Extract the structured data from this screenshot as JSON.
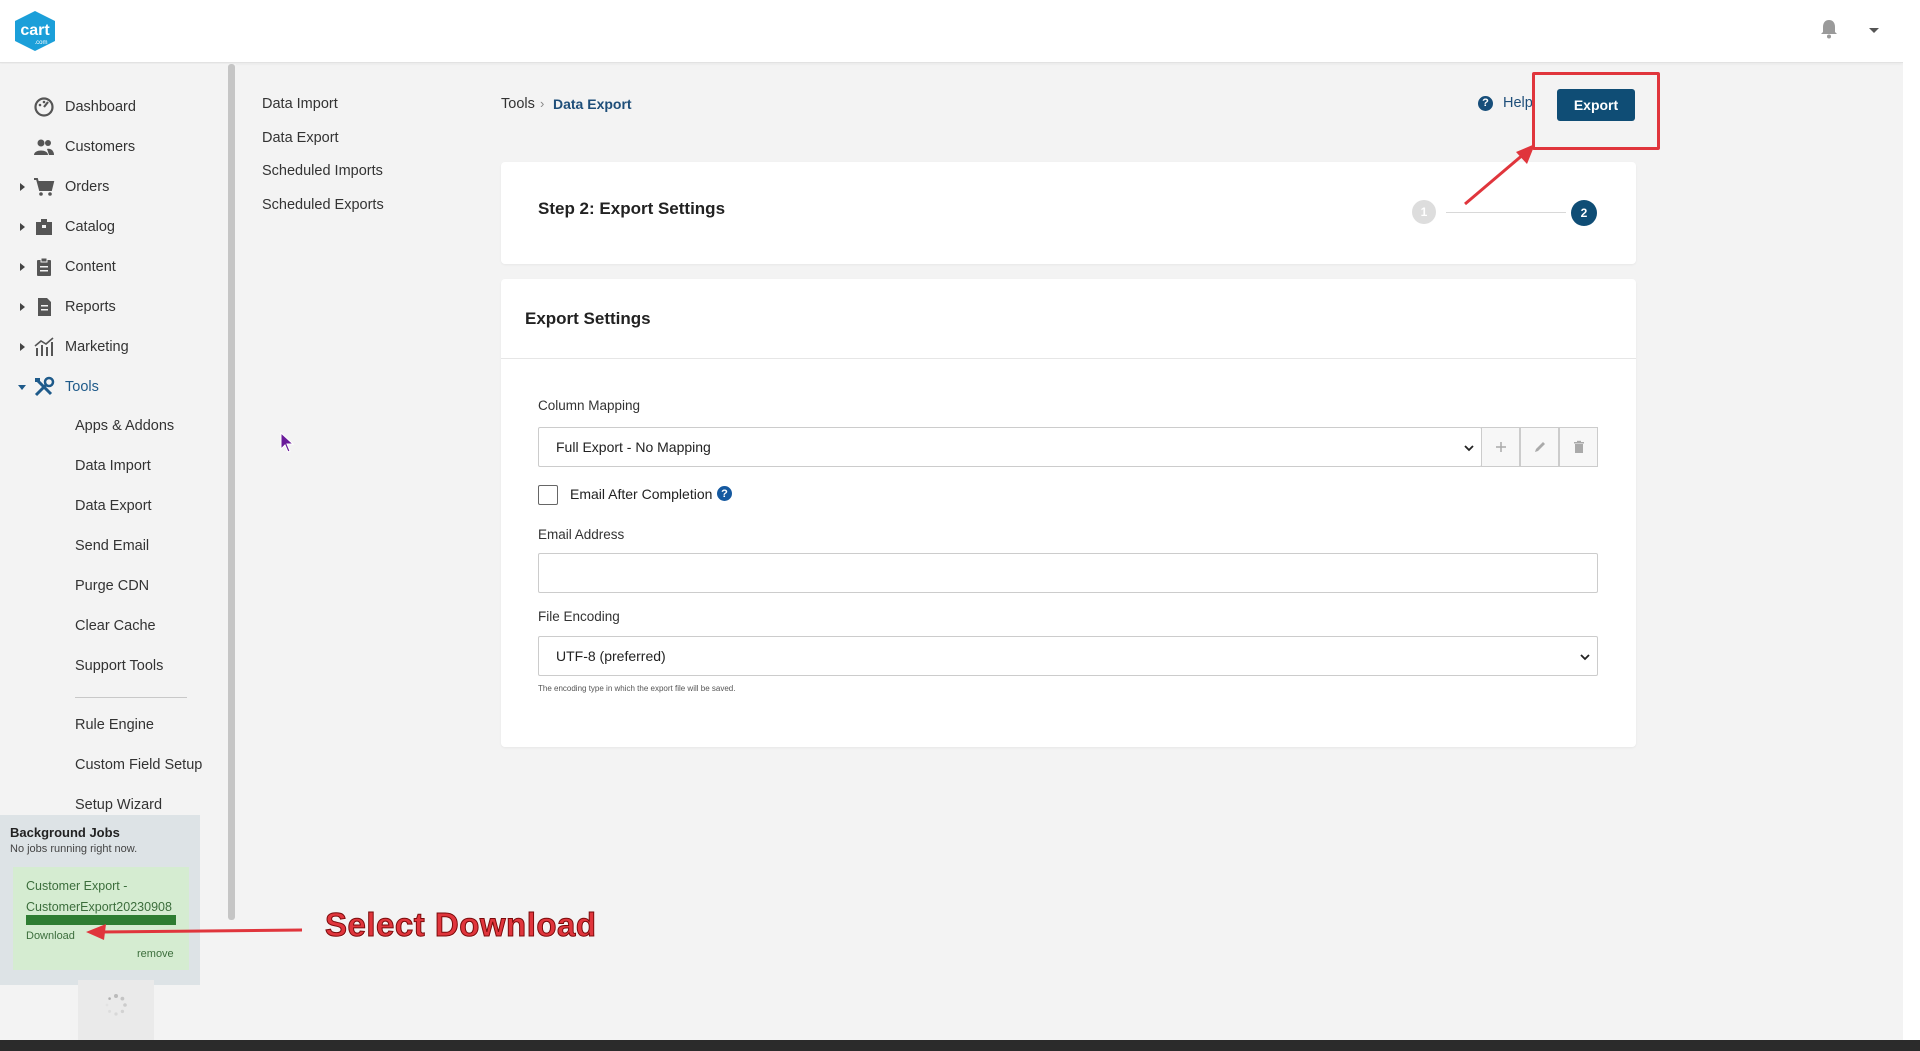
{
  "brand": {
    "logo_text": "cart",
    "logo_sub": ".com",
    "accent": "#0f4d75",
    "annotation_color": "#e0353c"
  },
  "header": {
    "bell_icon": "bell-icon",
    "dropdown_icon": "caret-down-icon"
  },
  "sidebar": {
    "items": [
      {
        "label": "Dashboard",
        "icon": "dashboard-icon",
        "expandable": false
      },
      {
        "label": "Customers",
        "icon": "users-icon",
        "expandable": false
      },
      {
        "label": "Orders",
        "icon": "cart-icon",
        "expandable": true
      },
      {
        "label": "Catalog",
        "icon": "box-icon",
        "expandable": true
      },
      {
        "label": "Content",
        "icon": "clipboard-icon",
        "expandable": true
      },
      {
        "label": "Reports",
        "icon": "report-icon",
        "expandable": true
      },
      {
        "label": "Marketing",
        "icon": "chart-icon",
        "expandable": true
      },
      {
        "label": "Tools",
        "icon": "tools-icon",
        "expandable": true,
        "expanded": true
      }
    ],
    "sub_items": [
      "Apps & Addons",
      "Data Import",
      "Data Export",
      "Send Email",
      "Purge CDN",
      "Clear Cache",
      "Support Tools"
    ],
    "sub_items_2": [
      "Rule Engine",
      "Custom Field Setup",
      "Setup Wizard"
    ]
  },
  "background_jobs": {
    "title": "Background Jobs",
    "status": "No jobs running right now.",
    "job": {
      "name_line1": "Customer Export -",
      "name_line2": "CustomerExport20230908",
      "progress": 1.0,
      "download_label": "Download",
      "remove_label": "remove"
    }
  },
  "tools_menu": [
    "Data Import",
    "Data Export",
    "Scheduled Imports",
    "Scheduled Exports"
  ],
  "breadcrumb": {
    "parent": "Tools",
    "separator": "›",
    "current": "Data Export"
  },
  "help_label": "Help",
  "export_button": "Export",
  "step_card": {
    "title": "Step 2: Export Settings",
    "step1": "1",
    "step2": "2"
  },
  "settings": {
    "title": "Export Settings",
    "column_mapping_label": "Column Mapping",
    "column_mapping_value": "Full Export - No Mapping",
    "email_after_label": "Email After Completion",
    "email_after_checked": false,
    "email_label": "Email Address",
    "email_value": "",
    "encoding_label": "File Encoding",
    "encoding_value": "UTF-8 (preferred)",
    "encoding_help": "The encoding type in which the export file will be saved."
  },
  "annotation": {
    "text": "Select Download"
  }
}
